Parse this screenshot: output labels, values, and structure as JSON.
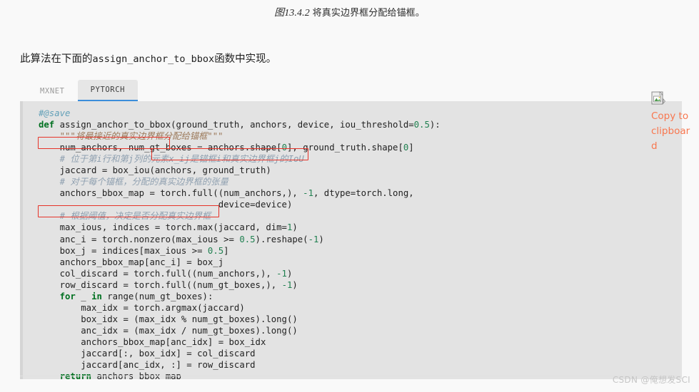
{
  "caption": {
    "figure_number": "图13.4.2",
    "text": "将真实边界框分配给锚框。"
  },
  "intro": {
    "prefix": "此算法在下面的",
    "code": "assign_anchor_to_bbox",
    "suffix": "函数中实现。"
  },
  "tabs": [
    {
      "label": "MXNET",
      "active": false
    },
    {
      "label": "PYTORCH",
      "active": true
    }
  ],
  "code": {
    "language": "python",
    "lines": [
      "#@save",
      "def assign_anchor_to_bbox(ground_truth, anchors, device, iou_threshold=0.5):",
      "    \"\"\"将最接近的真实边界框分配给锚框\"\"\"",
      "    num_anchors, num_gt_boxes = anchors.shape[0], ground_truth.shape[0]",
      "    # 位于第i行和第j列的元素x_ij是锚框i和真实边界框j的IoU",
      "    jaccard = box_iou(anchors, ground_truth)",
      "    # 对于每个锚框，分配的真实边界框的张量",
      "    anchors_bbox_map = torch.full((num_anchors,), -1, dtype=torch.long,",
      "                                  device=device)",
      "    # 根据阈值，决定是否分配真实边界框",
      "    max_ious, indices = torch.max(jaccard, dim=1)",
      "    anc_i = torch.nonzero(max_ious >= 0.5).reshape(-1)",
      "    box_j = indices[max_ious >= 0.5]",
      "    anchors_bbox_map[anc_i] = box_j",
      "    col_discard = torch.full((num_anchors,), -1)",
      "    row_discard = torch.full((num_gt_boxes,), -1)",
      "    for _ in range(num_gt_boxes):",
      "        max_idx = torch.argmax(jaccard)",
      "        box_idx = (max_idx % num_gt_boxes).long()",
      "        anc_idx = (max_idx / num_gt_boxes).long()",
      "        anchors_bbox_map[anc_idx] = box_idx",
      "        jaccard[:, box_idx] = col_discard",
      "        jaccard[anc_idx, :] = row_discard",
      "    return anchors_bbox_map"
    ]
  },
  "annotations": [
    {
      "name": "highlight-num-anchors",
      "text": "num_anchors, num_gt_boxes",
      "color": "#e63329"
    },
    {
      "name": "highlight-iou-comment",
      "text": "x_ij是锚框i和真实边界框j的IoU",
      "color": "#e63329"
    },
    {
      "name": "highlight-threshold-comment",
      "text": "# 根据阈值，决定是否分配真实边界框",
      "color": "#e63329"
    }
  ],
  "copy_widget": {
    "icon": "broken-image-icon",
    "label": "Copy to clipboard",
    "color": "#f8774f"
  },
  "watermark": {
    "text": "CSDN @俺想发SCI"
  }
}
